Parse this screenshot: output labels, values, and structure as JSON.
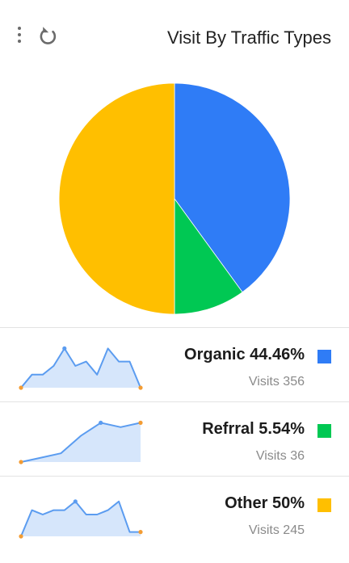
{
  "header": {
    "title": "Visit By Traffic Types",
    "menu_icon": "kebab-vertical-icon",
    "refresh_icon": "refresh-icon"
  },
  "colors": {
    "organic": "#2f7cf6",
    "referral": "#00c853",
    "other": "#ffbf00",
    "spark_line": "#5b9cf0",
    "spark_fill": "#d6e6fb",
    "spark_end": "#f39c33"
  },
  "chart_data": [
    {
      "type": "pie",
      "title": "Visit By Traffic Types",
      "categories": [
        "Organic",
        "Refrral",
        "Other"
      ],
      "values": [
        40,
        10,
        50
      ],
      "colors": [
        "#2f7cf6",
        "#00c853",
        "#ffbf00"
      ]
    },
    {
      "type": "area",
      "name": "Organic",
      "x": [
        0,
        1,
        2,
        3,
        4,
        5,
        6,
        7,
        8,
        9,
        10,
        11
      ],
      "values": [
        0,
        3,
        3,
        5,
        9,
        5,
        6,
        3,
        9,
        6,
        6,
        0
      ]
    },
    {
      "type": "area",
      "name": "Refrral",
      "x": [
        0,
        1,
        2,
        3,
        4,
        5,
        6
      ],
      "values": [
        0,
        1,
        2,
        6,
        9,
        8,
        9
      ]
    },
    {
      "type": "area",
      "name": "Other",
      "x": [
        0,
        1,
        2,
        3,
        4,
        5,
        6,
        7,
        8,
        9,
        10,
        11
      ],
      "values": [
        0,
        6,
        5,
        6,
        6,
        8,
        5,
        5,
        6,
        8,
        1,
        1
      ]
    }
  ],
  "rows": [
    {
      "label": "Organic",
      "percent": "44.46%",
      "visits_label": "Visits",
      "visits": "356"
    },
    {
      "label": "Refrral",
      "percent": "5.54%",
      "visits_label": "Visits",
      "visits": "36"
    },
    {
      "label": "Other",
      "percent": "50%",
      "visits_label": "Visits",
      "visits": "245"
    }
  ]
}
